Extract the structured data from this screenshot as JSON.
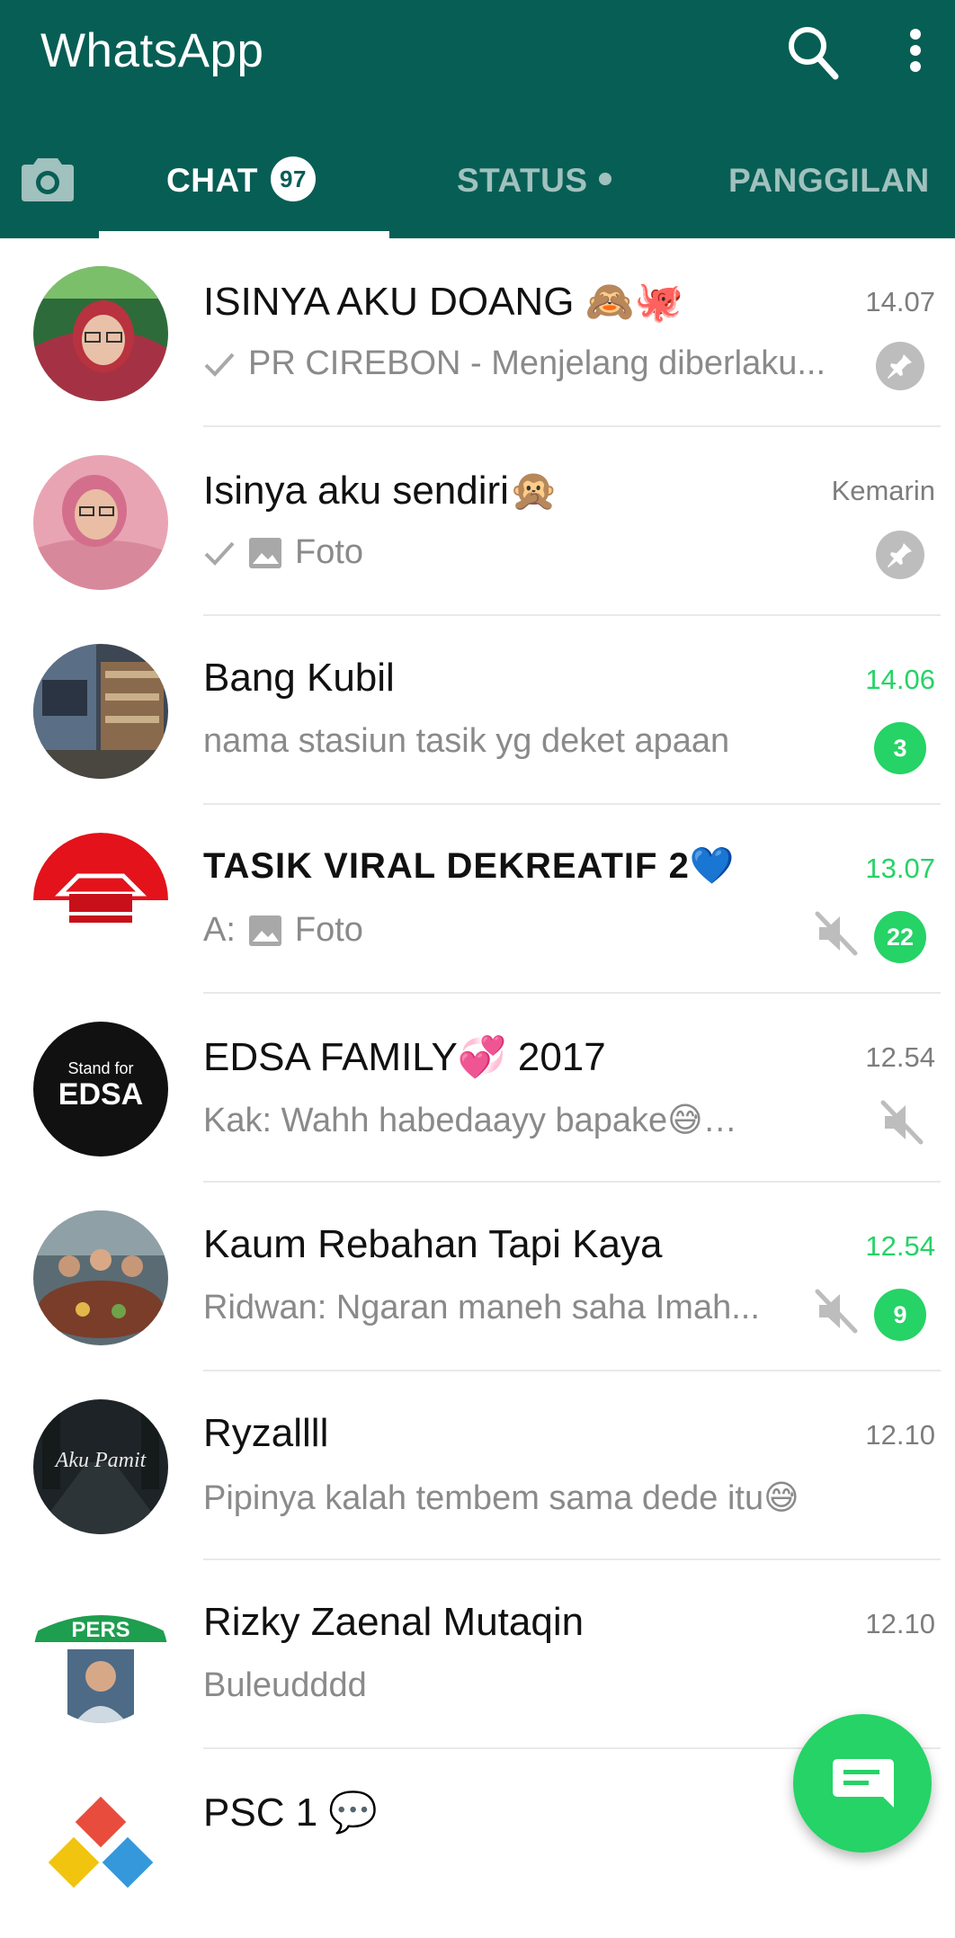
{
  "app": {
    "title": "WhatsApp",
    "colors": {
      "header": "#075e54",
      "accent": "#25d366",
      "tab_inactive": "rgba(255,255,255,0.62)"
    }
  },
  "toolbar": {
    "search_icon": "search-icon",
    "menu_icon": "more-vert-icon"
  },
  "tabs": {
    "camera_icon": "camera-icon",
    "chat": {
      "label": "CHAT",
      "badge": "97"
    },
    "status": {
      "label": "STATUS"
    },
    "calls": {
      "label": "PANGGILAN"
    }
  },
  "chats": [
    {
      "name": "ISINYA AKU DOANG 🙈🐙",
      "time": "14.07",
      "preview": "PR CIREBON - Menjelang diberlaku...",
      "sent_tick": true,
      "pinned": true
    },
    {
      "name": "Isinya aku sendiri🙊",
      "time": "Kemarin",
      "preview": "Foto",
      "sent_tick": true,
      "photo": true,
      "pinned": true
    },
    {
      "name": "Bang Kubil",
      "time": "14.06",
      "preview": "nama stasiun tasik yg deket apaan",
      "unread": "3"
    },
    {
      "name": "TASIK VIRAL DEKREATIF 2💙",
      "time": "13.07",
      "preview_prefix": "A:",
      "preview": "Foto",
      "photo": true,
      "muted": true,
      "unread": "22"
    },
    {
      "name": "EDSA FAMILY💞 2017",
      "time": "12.54",
      "preview": "Kak: Wahh habedaayy bapake😅🥳 @...",
      "muted": true
    },
    {
      "name": "Kaum Rebahan Tapi Kaya",
      "time": "12.54",
      "preview": "Ridwan: Ngaran maneh saha Imah...",
      "muted": true,
      "unread": "9"
    },
    {
      "name": "Ryzallll",
      "time": "12.10",
      "preview": "Pipinya kalah tembem sama dede itu😅"
    },
    {
      "name": "Rizky Zaenal Mutaqin",
      "time": "12.10",
      "preview": "Buleudddd"
    },
    {
      "name": "PSC 1 💬",
      "time": "",
      "preview": ""
    }
  ],
  "avatars": {
    "rizky_caption": "PERS",
    "edsa_line1": "Stand for",
    "edsa_line2": "EDSA",
    "ryzal_caption": "Aku Pamit"
  },
  "fab": {
    "icon": "new-chat-icon"
  }
}
